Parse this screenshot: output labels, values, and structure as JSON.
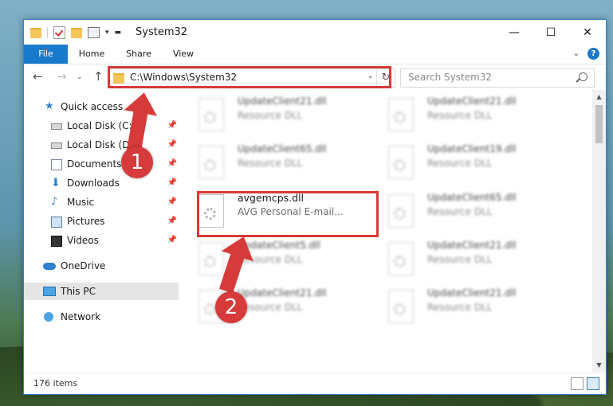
{
  "window": {
    "title": "System32"
  },
  "ribbon": {
    "tabs": [
      "File",
      "Home",
      "Share",
      "View"
    ]
  },
  "address_bar": {
    "path": "C:\\Windows\\System32"
  },
  "search": {
    "placeholder": "Search System32"
  },
  "sidebar": {
    "items": [
      {
        "label": "Quick access",
        "icon": "star-icon",
        "pinned": false
      },
      {
        "label": "Local Disk (C:)",
        "icon": "disk-icon",
        "pinned": true
      },
      {
        "label": "Local Disk (D:)",
        "icon": "disk-icon",
        "pinned": true
      },
      {
        "label": "Documents",
        "icon": "documents-icon",
        "pinned": true
      },
      {
        "label": "Downloads",
        "icon": "download-icon",
        "pinned": true
      },
      {
        "label": "Music",
        "icon": "music-icon",
        "pinned": true
      },
      {
        "label": "Pictures",
        "icon": "pictures-icon",
        "pinned": true
      },
      {
        "label": "Videos",
        "icon": "videos-icon",
        "pinned": true
      },
      {
        "label": "OneDrive",
        "icon": "cloud-icon",
        "pinned": false
      },
      {
        "label": "This PC",
        "icon": "computer-icon",
        "pinned": false
      },
      {
        "label": "Network",
        "icon": "network-icon",
        "pinned": false
      }
    ],
    "selected": "This PC"
  },
  "files": [
    {
      "name": "UpdateClient21.dll",
      "desc": "Resource DLL"
    },
    {
      "name": "UpdateClient21.dll",
      "desc": "Resource DLL"
    },
    {
      "name": "UpdateClient65.dll",
      "desc": "Resource DLL"
    },
    {
      "name": "UpdateClient19.dll",
      "desc": "Resource DLL"
    },
    {
      "name": "avgemcps.dll",
      "desc": "AVG Personal E-mail..."
    },
    {
      "name": "UpdateClient65.dll",
      "desc": "Resource DLL"
    },
    {
      "name": "UpdateClient5.dll",
      "desc": "Resource DLL"
    },
    {
      "name": "UpdateClient21.dll",
      "desc": "Resource DLL"
    },
    {
      "name": "UpdateClient21.dll",
      "desc": "Resource DLL"
    },
    {
      "name": "UpdateClient21.dll",
      "desc": "Resource DLL"
    }
  ],
  "status": {
    "item_count": "176 items"
  },
  "annotations": {
    "step1": "1",
    "step2": "2",
    "color": "#d63a3a"
  }
}
